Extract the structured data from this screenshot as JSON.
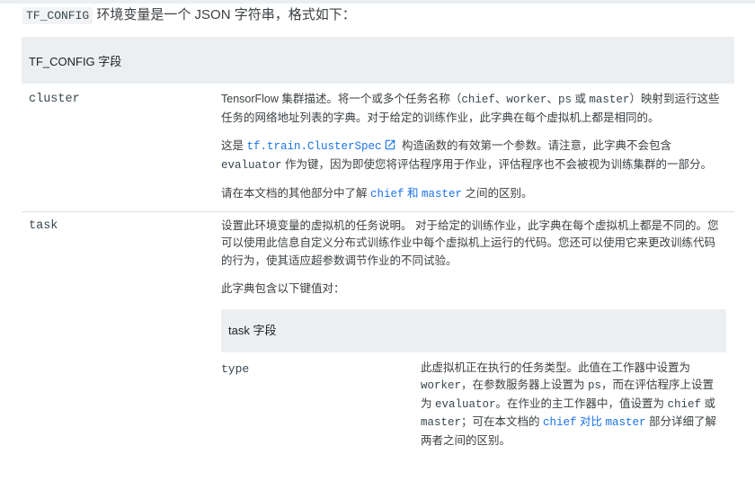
{
  "intro": {
    "code": "TF_CONFIG",
    "text": " 环境变量是一个 JSON 字符串，格式如下："
  },
  "table": {
    "header": "TF_CONFIG 字段",
    "rows": [
      {
        "key": "cluster",
        "paragraphs": [
          [
            {
              "t": "text",
              "v": "TensorFlow 集群描述。将一个或多个任务名称（"
            },
            {
              "t": "code",
              "v": "chief"
            },
            {
              "t": "text",
              "v": "、"
            },
            {
              "t": "code",
              "v": "worker"
            },
            {
              "t": "text",
              "v": "、"
            },
            {
              "t": "code",
              "v": "ps"
            },
            {
              "t": "text",
              "v": " 或 "
            },
            {
              "t": "code",
              "v": "master"
            },
            {
              "t": "text",
              "v": "）映射到运行这些任务的网络地址列表的字典。对于给定的训练作业，此字典在每个虚拟机上都是相同的。"
            }
          ],
          [
            {
              "t": "text",
              "v": "这是 "
            },
            {
              "t": "link-code",
              "v": "tf.train.ClusterSpec"
            },
            {
              "t": "icon",
              "v": "external-link-icon"
            },
            {
              "t": "text",
              "v": " 构造函数的有效第一个参数。请注意，此字典不会包含 "
            },
            {
              "t": "code",
              "v": "evaluator"
            },
            {
              "t": "text",
              "v": " 作为键，因为即使您将评估程序用于作业，评估程序也不会被视为训练集群的一部分。"
            }
          ],
          [
            {
              "t": "text",
              "v": "请在本文档的其他部分中了解 "
            },
            {
              "t": "link-mixed",
              "v": [
                {
                  "t": "code",
                  "v": "chief"
                },
                {
                  "t": "text",
                  "v": " 和 "
                },
                {
                  "t": "code",
                  "v": "master"
                }
              ]
            },
            {
              "t": "text",
              "v": " 之间的区别。"
            }
          ]
        ]
      },
      {
        "key": "task",
        "paragraphs": [
          [
            {
              "t": "text",
              "v": "设置此环境变量的虚拟机的任务说明。 对于给定的训练作业，此字典在每个虚拟机上都是不同的。您可以使用此信息自定义分布式训练作业中每个虚拟机上运行的代码。您还可以使用它来更改训练代码的行为，使其适应超参数调节作业的不同试验。"
            }
          ],
          [
            {
              "t": "text",
              "v": "此字典包含以下键值对："
            }
          ]
        ],
        "subtable": {
          "header": "task 字段",
          "rows": [
            {
              "key": "type",
              "paragraph": [
                {
                  "t": "text",
                  "v": "此虚拟机正在执行的任务类型。此值在工作器中设置为 "
                },
                {
                  "t": "code",
                  "v": "worker"
                },
                {
                  "t": "text",
                  "v": "，在参数服务器上设置为 "
                },
                {
                  "t": "code",
                  "v": "ps"
                },
                {
                  "t": "text",
                  "v": "，而在评估程序上设置为 "
                },
                {
                  "t": "code",
                  "v": "evaluator"
                },
                {
                  "t": "text",
                  "v": "。在作业的主工作器中，值设置为 "
                },
                {
                  "t": "code",
                  "v": "chief"
                },
                {
                  "t": "text",
                  "v": " 或 "
                },
                {
                  "t": "code",
                  "v": "master"
                },
                {
                  "t": "text",
                  "v": "；可在本文档的 "
                },
                {
                  "t": "link-mixed",
                  "v": [
                    {
                      "t": "code",
                      "v": "chief"
                    },
                    {
                      "t": "text",
                      "v": " 对比 "
                    },
                    {
                      "t": "code",
                      "v": "master"
                    }
                  ]
                },
                {
                  "t": "text",
                  "v": " 部分详细了解两者之间的区别。"
                }
              ]
            }
          ]
        }
      }
    ]
  },
  "colors": {
    "link": "#1a73e8",
    "header_bg": "#eceff1",
    "code_text": "#37474f"
  }
}
